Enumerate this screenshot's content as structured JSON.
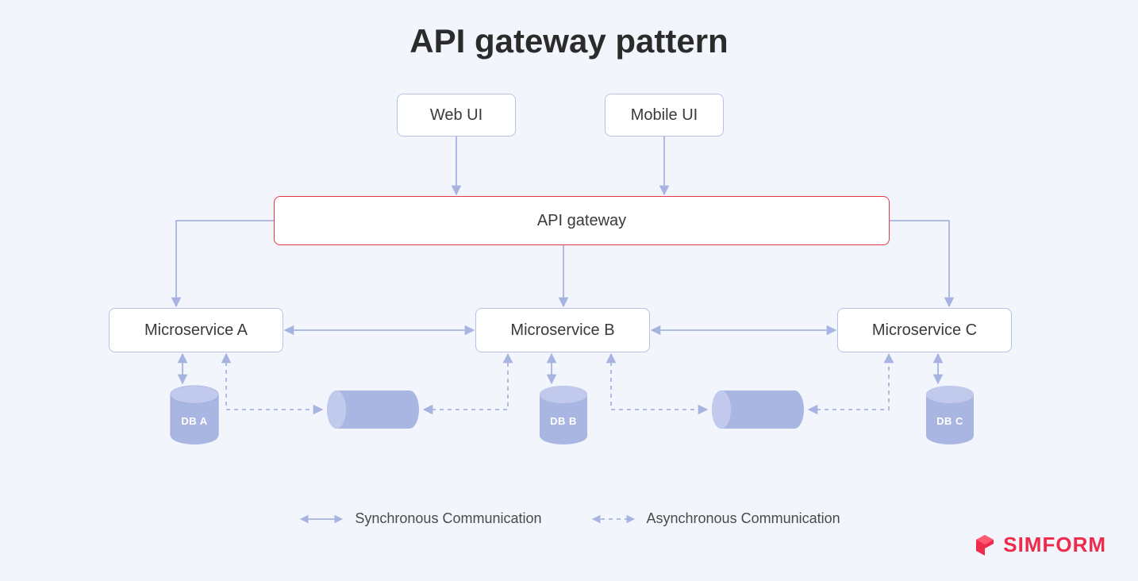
{
  "title": "API gateway pattern",
  "nodes": {
    "web_ui": "Web UI",
    "mobile_ui": "Mobile UI",
    "gateway": "API gateway",
    "ms_a": "Microservice A",
    "ms_b": "Microservice B",
    "ms_c": "Microservice C",
    "db_a": "DB A",
    "db_b": "DB B",
    "db_c": "DB C"
  },
  "legend": {
    "sync": "Synchronous Communication",
    "async": "Asynchronous Communication"
  },
  "brand": "SIMFORM",
  "colors": {
    "bg": "#f2f5fc",
    "box_border": "#b8c2e8",
    "gateway_border": "#e53946",
    "arrow": "#a7b3e0",
    "shape_fill": "#aab6e2",
    "text": "#3a3a3a",
    "brand": "#ee2b4a"
  },
  "diagram": {
    "clients": [
      "Web UI",
      "Mobile UI"
    ],
    "gateway": "API gateway",
    "services": [
      {
        "name": "Microservice A",
        "db": "DB A"
      },
      {
        "name": "Microservice B",
        "db": "DB B"
      },
      {
        "name": "Microservice C",
        "db": "DB C"
      }
    ],
    "sync_edges": [
      [
        "Web UI",
        "API gateway"
      ],
      [
        "Mobile UI",
        "API gateway"
      ],
      [
        "API gateway",
        "Microservice A"
      ],
      [
        "API gateway",
        "Microservice B"
      ],
      [
        "API gateway",
        "Microservice C"
      ],
      [
        "Microservice A",
        "Microservice B"
      ],
      [
        "Microservice B",
        "Microservice C"
      ],
      [
        "Microservice A",
        "DB A"
      ],
      [
        "Microservice B",
        "DB B"
      ],
      [
        "Microservice C",
        "DB C"
      ]
    ],
    "async_edges": [
      [
        "Microservice A",
        "Queue AB"
      ],
      [
        "Queue AB",
        "Microservice B"
      ],
      [
        "Microservice B",
        "Queue BC"
      ],
      [
        "Queue BC",
        "Microservice C"
      ]
    ],
    "queues": [
      "Queue AB",
      "Queue BC"
    ]
  }
}
